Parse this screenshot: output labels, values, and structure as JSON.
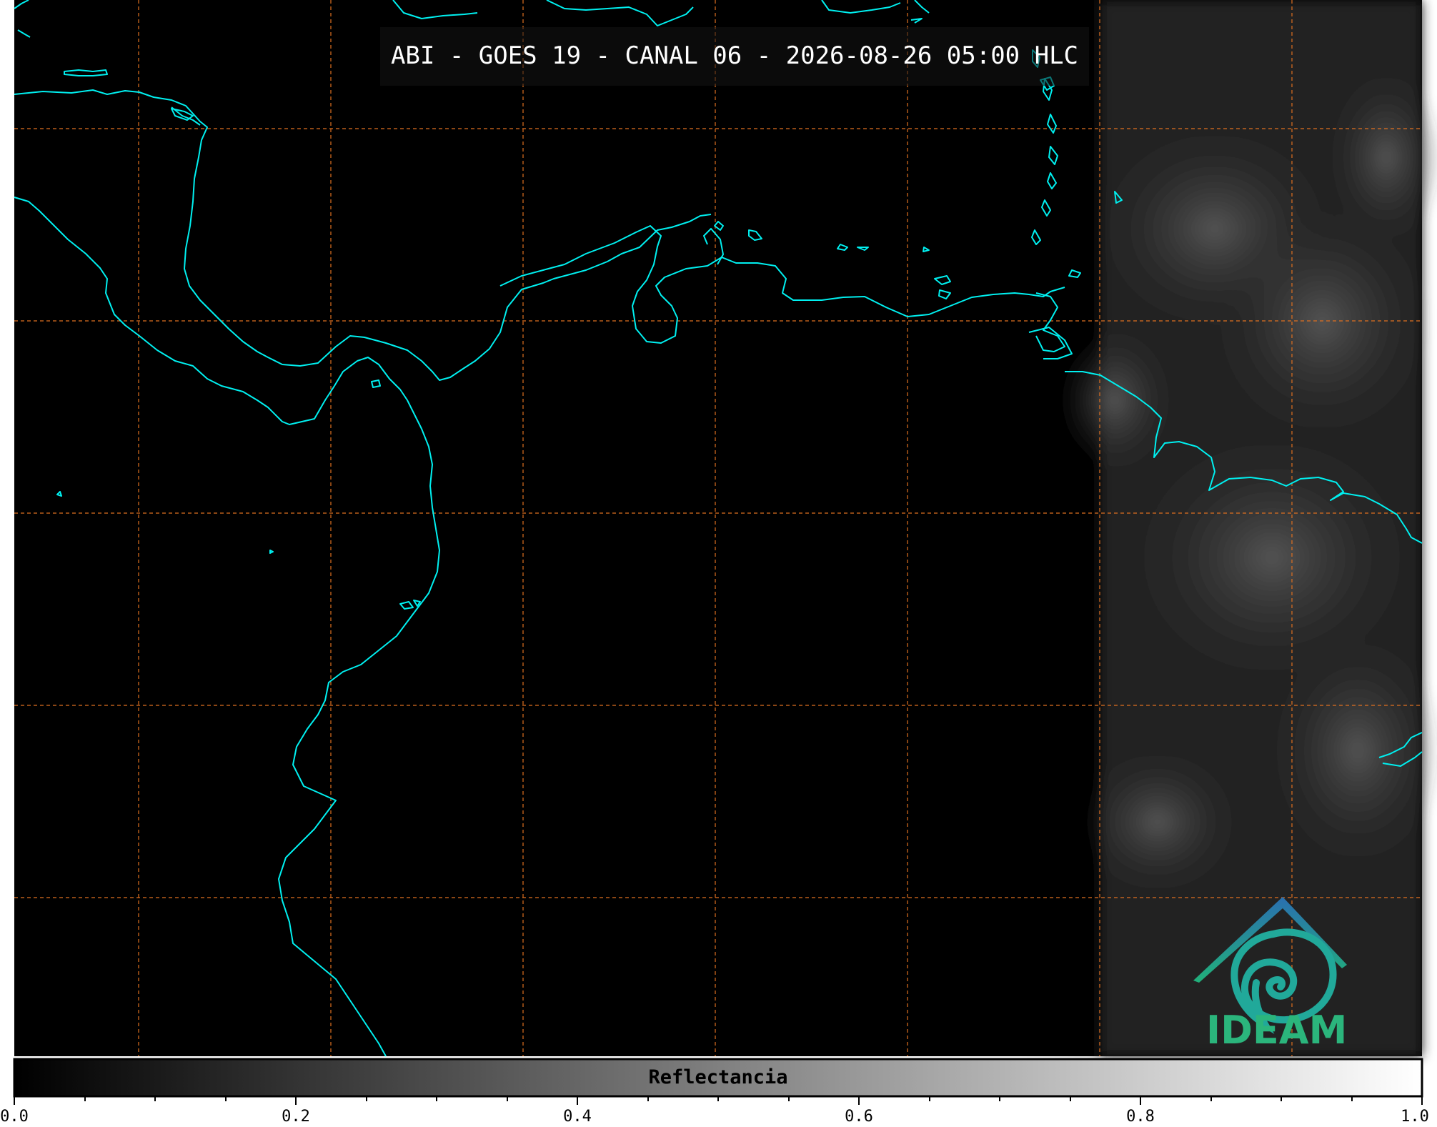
{
  "title": "ABI - GOES 19 - CANAL 06 - 2026-08-26 05:00 HLC",
  "colorbar": {
    "label": "Reflectancia",
    "ticks": [
      "0.0",
      "0.2",
      "0.4",
      "0.6",
      "0.8",
      "1.0"
    ],
    "range": [
      0.0,
      1.0
    ],
    "colormap": [
      "#000000",
      "#ffffff"
    ]
  },
  "logo": {
    "text": "IDEAM"
  },
  "colors": {
    "coastline": "#00f0f0",
    "gridlines": "#e07020",
    "background": "#000000",
    "logo_text": "#2bb57c",
    "logo_roof": "#2a6fb0",
    "logo_swirl": "#21a99a"
  }
}
